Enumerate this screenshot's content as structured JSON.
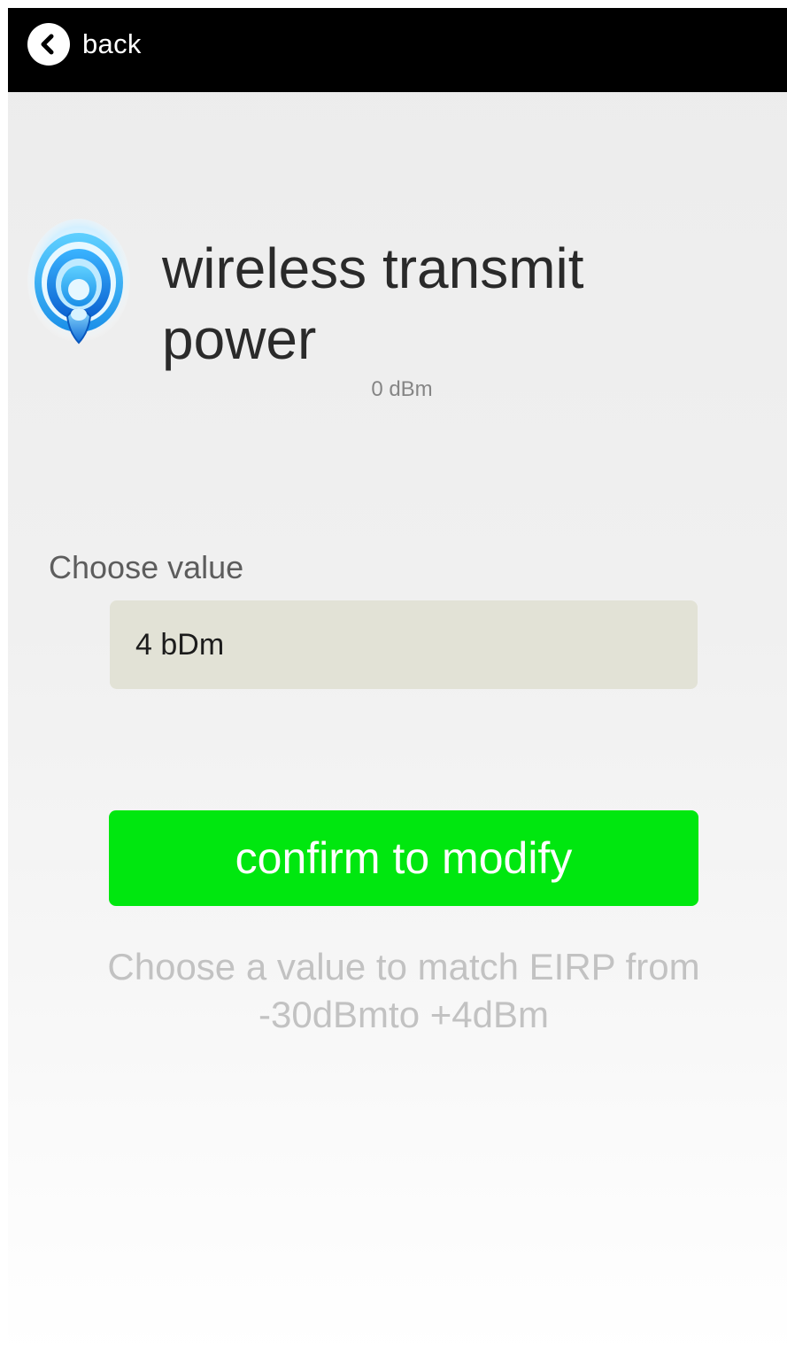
{
  "header": {
    "back_label": "back"
  },
  "setting": {
    "icon": "wifi-signal-icon",
    "title": "wireless transmit power",
    "current_value": "0 dBm"
  },
  "form": {
    "choose_label": "Choose value",
    "selected_value": "4 bDm",
    "confirm_label": "confirm to modify",
    "hint": "Choose a value to match EIRP from -30dBmto +4dBm"
  },
  "colors": {
    "topbar": "#000000",
    "confirm_button": "#00e70f",
    "value_field": "#e2e2d6",
    "hint_text": "#c2c2c2"
  }
}
